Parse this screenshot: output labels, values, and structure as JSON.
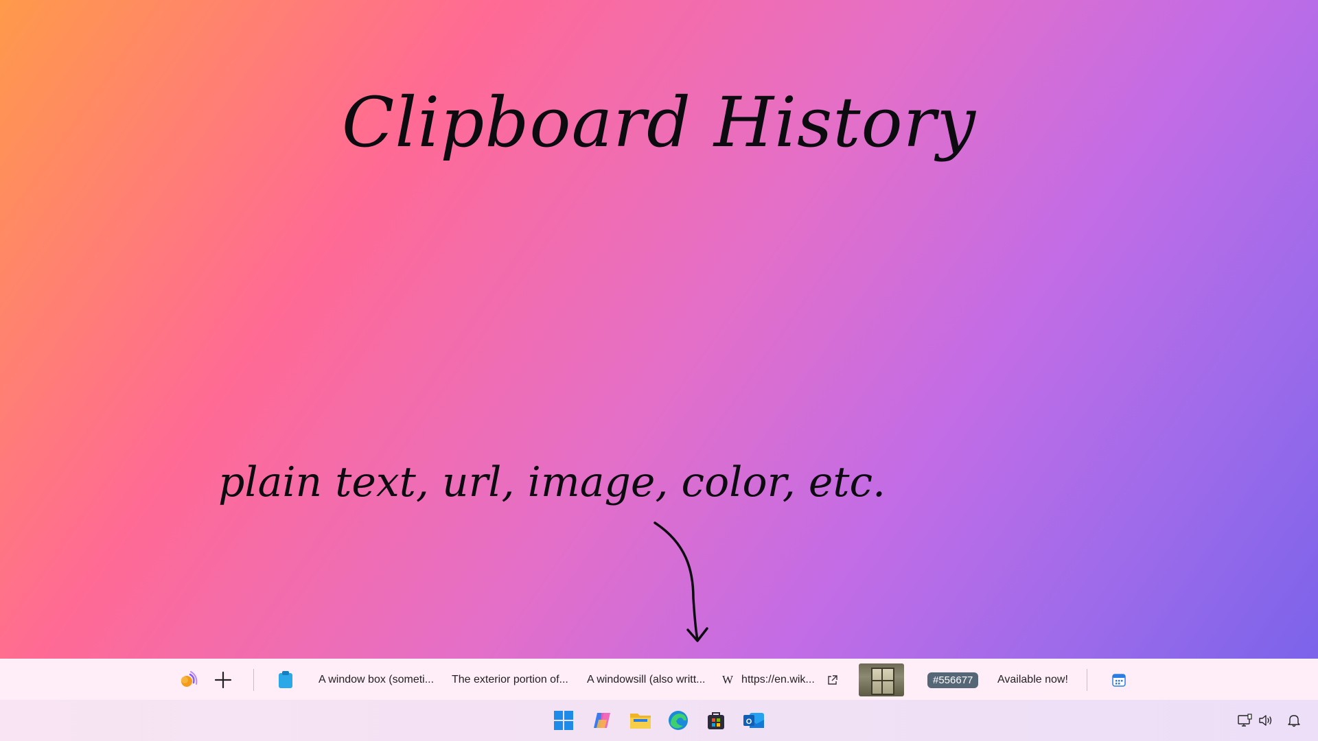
{
  "desktop": {
    "title": "Clipboard History",
    "subtitle": "plain text, url, image, color, etc."
  },
  "clipboard_bar": {
    "app_icon": "clipboard-app-icon",
    "add_icon": "plus-icon",
    "clip_icon": "clipboard-icon",
    "items": [
      {
        "type": "text",
        "label": "A window box (someti..."
      },
      {
        "type": "text",
        "label": "The exterior portion of..."
      },
      {
        "type": "text",
        "label": "A windowsill (also writt..."
      },
      {
        "type": "url",
        "label": "https://en.wik...",
        "icon": "wikipedia-icon",
        "open_icon": "external-link-icon"
      },
      {
        "type": "image",
        "icon": "image-thumbnail"
      },
      {
        "type": "color",
        "label": "#556677",
        "color": "#556677"
      },
      {
        "type": "text",
        "label": "Available now!"
      }
    ],
    "calendar_icon": "calendar-icon"
  },
  "taskbar": {
    "apps": [
      {
        "name": "start",
        "icon": "windows-start-icon"
      },
      {
        "name": "copilot",
        "icon": "copilot-icon"
      },
      {
        "name": "file-explorer",
        "icon": "folder-icon"
      },
      {
        "name": "edge",
        "icon": "edge-icon"
      },
      {
        "name": "store",
        "icon": "store-icon"
      },
      {
        "name": "outlook",
        "icon": "outlook-icon"
      }
    ],
    "tray": [
      "network-icon",
      "volume-icon",
      "notification-bell-icon"
    ]
  }
}
